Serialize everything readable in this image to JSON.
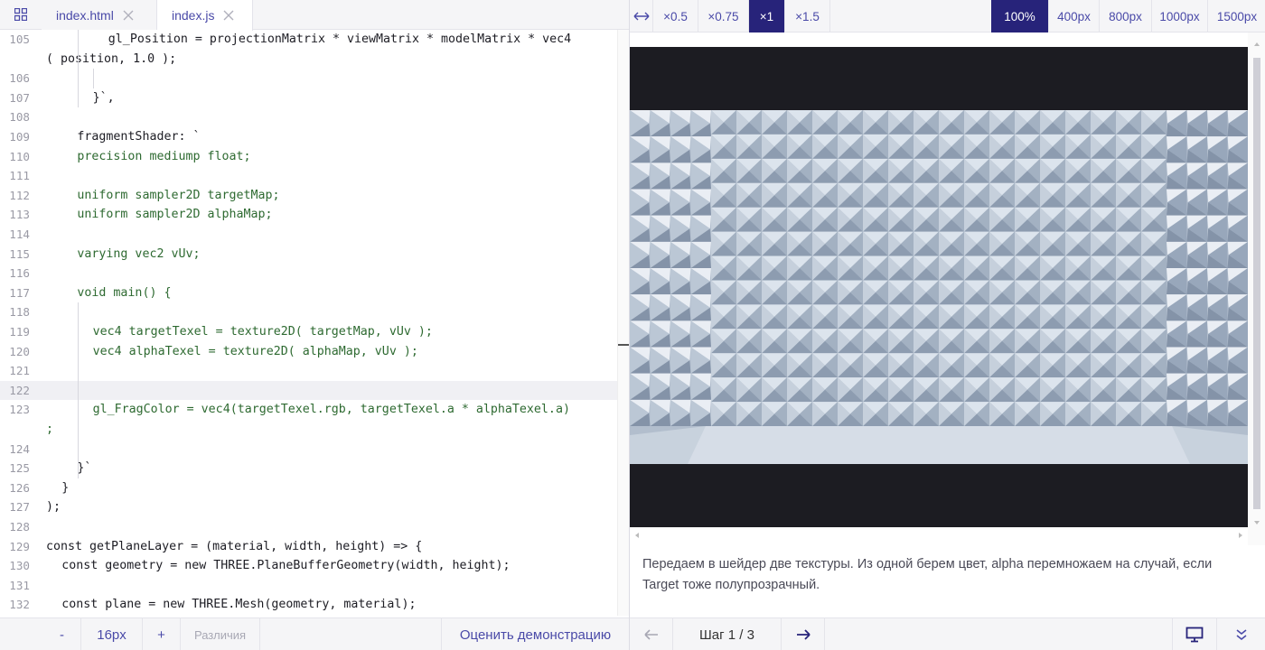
{
  "editor": {
    "tabs": [
      {
        "label": "index.html",
        "active": false
      },
      {
        "label": "index.js",
        "active": true
      }
    ],
    "lines": [
      {
        "no": "105",
        "text": "gl_Position = projectionMatrix * viewMatrix * modelMatrix * vec4",
        "kind": "plain"
      },
      {
        "no": "",
        "text": "( position, 1.0 );",
        "kind": "plain"
      },
      {
        "no": "106",
        "text": "",
        "kind": "plain"
      },
      {
        "no": "107",
        "text": "}`,",
        "kind": "plain"
      },
      {
        "no": "108",
        "text": "",
        "kind": "plain"
      },
      {
        "no": "109",
        "text": "fragmentShader: `",
        "kind": "plain"
      },
      {
        "no": "110",
        "text": "precision mediump float;",
        "kind": "str"
      },
      {
        "no": "111",
        "text": "",
        "kind": "plain"
      },
      {
        "no": "112",
        "text": "uniform sampler2D targetMap;",
        "kind": "str"
      },
      {
        "no": "113",
        "text": "uniform sampler2D alphaMap;",
        "kind": "str"
      },
      {
        "no": "114",
        "text": "",
        "kind": "plain"
      },
      {
        "no": "115",
        "text": "varying vec2 vUv;",
        "kind": "str"
      },
      {
        "no": "116",
        "text": "",
        "kind": "plain"
      },
      {
        "no": "117",
        "text": "void main() {",
        "kind": "str"
      },
      {
        "no": "118",
        "text": "",
        "kind": "plain"
      },
      {
        "no": "119",
        "text": "vec4 targetTexel = texture2D( targetMap, vUv );",
        "kind": "str"
      },
      {
        "no": "120",
        "text": "vec4 alphaTexel = texture2D( alphaMap, vUv );",
        "kind": "str"
      },
      {
        "no": "121",
        "text": "",
        "kind": "plain"
      },
      {
        "no": "122",
        "text": "",
        "kind": "plain"
      },
      {
        "no": "123",
        "text": "gl_FragColor = vec4(targetTexel.rgb, targetTexel.a * alphaTexel.a)",
        "kind": "str"
      },
      {
        "no": "",
        "text": ";",
        "kind": "str"
      },
      {
        "no": "124",
        "text": "",
        "kind": "plain"
      },
      {
        "no": "125",
        "text": "}`",
        "kind": "plain"
      },
      {
        "no": "126",
        "text": "}",
        "kind": "plain"
      },
      {
        "no": "127",
        "text": ");",
        "kind": "plain"
      },
      {
        "no": "128",
        "text": "",
        "kind": "plain"
      },
      {
        "no": "129",
        "text": "const getPlaneLayer = (material, width, height) => {",
        "kind": "plain"
      },
      {
        "no": "130",
        "text": "const geometry = new THREE.PlaneBufferGeometry(width, height);",
        "kind": "plain"
      },
      {
        "no": "131",
        "text": "",
        "kind": "plain"
      },
      {
        "no": "132",
        "text": "const plane = new THREE.Mesh(geometry, material);",
        "kind": "plain"
      }
    ],
    "active_line": "122"
  },
  "editor_footer": {
    "decrease": "-",
    "font_size": "16px",
    "increase": "+",
    "diff": "Различия",
    "rate": "Оценить демонстрацию"
  },
  "preview_toolbar": {
    "scales": [
      "×0.5",
      "×0.75",
      "×1",
      "×1.5"
    ],
    "active_scale": "×1",
    "widths": [
      "100%",
      "400px",
      "800px",
      "1000px",
      "1500px"
    ],
    "active_width": "100%"
  },
  "description": "Передаем в шейдер две текстуры. Из одной берем цвет, alpha перемножаем на случай, если Target тоже полупрозрачный.",
  "preview_footer": {
    "step": "Шаг 1 / 3"
  },
  "colors": {
    "accent": "#27237a",
    "link": "#4a4aa8",
    "string": "#2e6a31",
    "keyword": "#2f53b5",
    "stage_bg": "#1c1c22",
    "panel_bg": "#f5f5f7"
  },
  "icons": {
    "menu": "grid-icon",
    "close": "close-icon",
    "resize": "horizontal-arrows-icon",
    "prev": "arrow-left-icon",
    "next": "arrow-right-icon",
    "present": "monitor-icon",
    "more": "double-chevron-down-icon"
  }
}
